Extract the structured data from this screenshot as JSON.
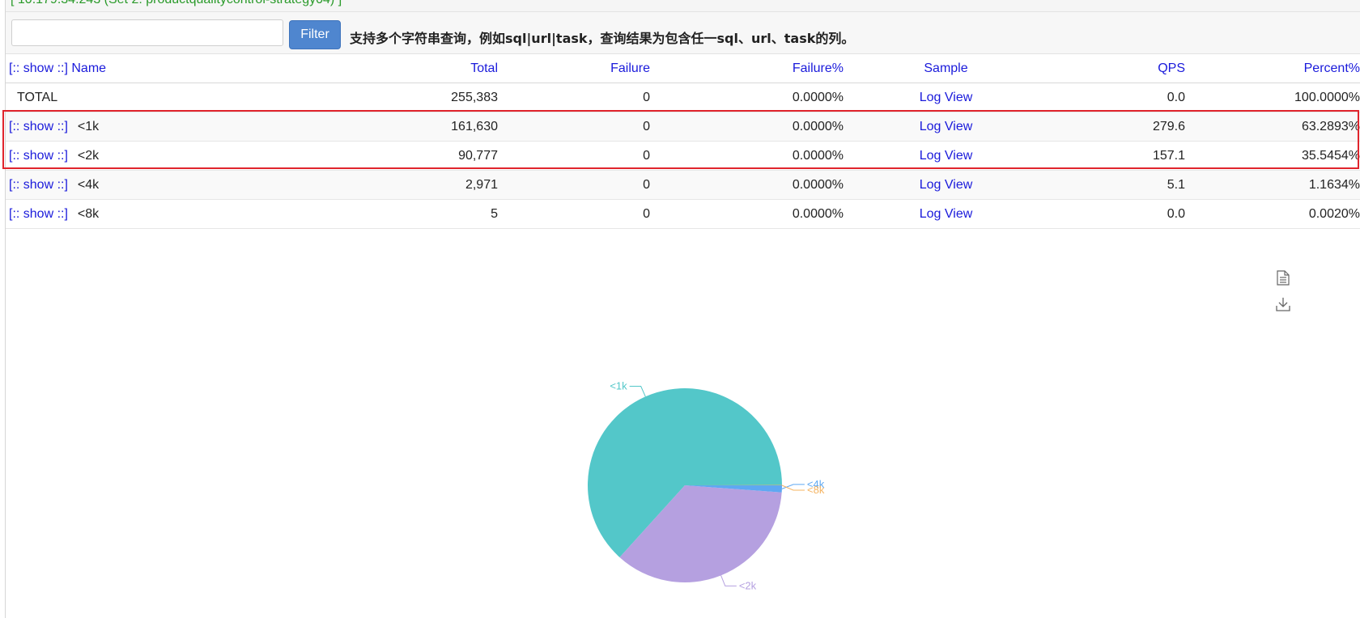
{
  "top_strip": {
    "text": "[ 10.179.34.243 (Set 2: productqualitycontrol-strategy04) ]"
  },
  "filter": {
    "input_value": "",
    "button_label": "Filter",
    "hint": "支持多个字符串查询，例如sql|url|task，查询结果为包含任一sql、url、task的列。"
  },
  "table": {
    "headers": {
      "show_toggle": "[:: show ::]",
      "name": "Name",
      "total": "Total",
      "failure": "Failure",
      "failure_pct": "Failure%",
      "sample": "Sample",
      "qps": "QPS",
      "percent": "Percent%"
    },
    "total_row": {
      "name": "TOTAL",
      "total": "255,383",
      "failure": "0",
      "failure_pct": "0.0000%",
      "sample": "Log View",
      "qps": "0.0",
      "percent": "100.0000%"
    },
    "rows": [
      {
        "show": "[:: show ::]",
        "name": "<1k",
        "total": "161,630",
        "failure": "0",
        "failure_pct": "0.0000%",
        "sample": "Log View",
        "qps": "279.6",
        "percent": "63.2893%"
      },
      {
        "show": "[:: show ::]",
        "name": "<2k",
        "total": "90,777",
        "failure": "0",
        "failure_pct": "0.0000%",
        "sample": "Log View",
        "qps": "157.1",
        "percent": "35.5454%"
      },
      {
        "show": "[:: show ::]",
        "name": "<4k",
        "total": "2,971",
        "failure": "0",
        "failure_pct": "0.0000%",
        "sample": "Log View",
        "qps": "5.1",
        "percent": "1.1634%"
      },
      {
        "show": "[:: show ::]",
        "name": "<8k",
        "total": "5",
        "failure": "0",
        "failure_pct": "0.0000%",
        "sample": "Log View",
        "qps": "0.0",
        "percent": "0.0020%"
      }
    ]
  },
  "toolbox": {
    "icons": [
      "data-view-icon",
      "save-image-icon"
    ]
  },
  "chart_data": {
    "type": "pie",
    "title": "",
    "series": [
      {
        "name": "<1k",
        "value": 161630,
        "color": "#53c7c9"
      },
      {
        "name": "<2k",
        "value": 90777,
        "color": "#b5a0e0"
      },
      {
        "name": "<4k",
        "value": 2971,
        "color": "#5ea8f2"
      },
      {
        "name": "<8k",
        "value": 5,
        "color": "#f5b462"
      }
    ]
  }
}
